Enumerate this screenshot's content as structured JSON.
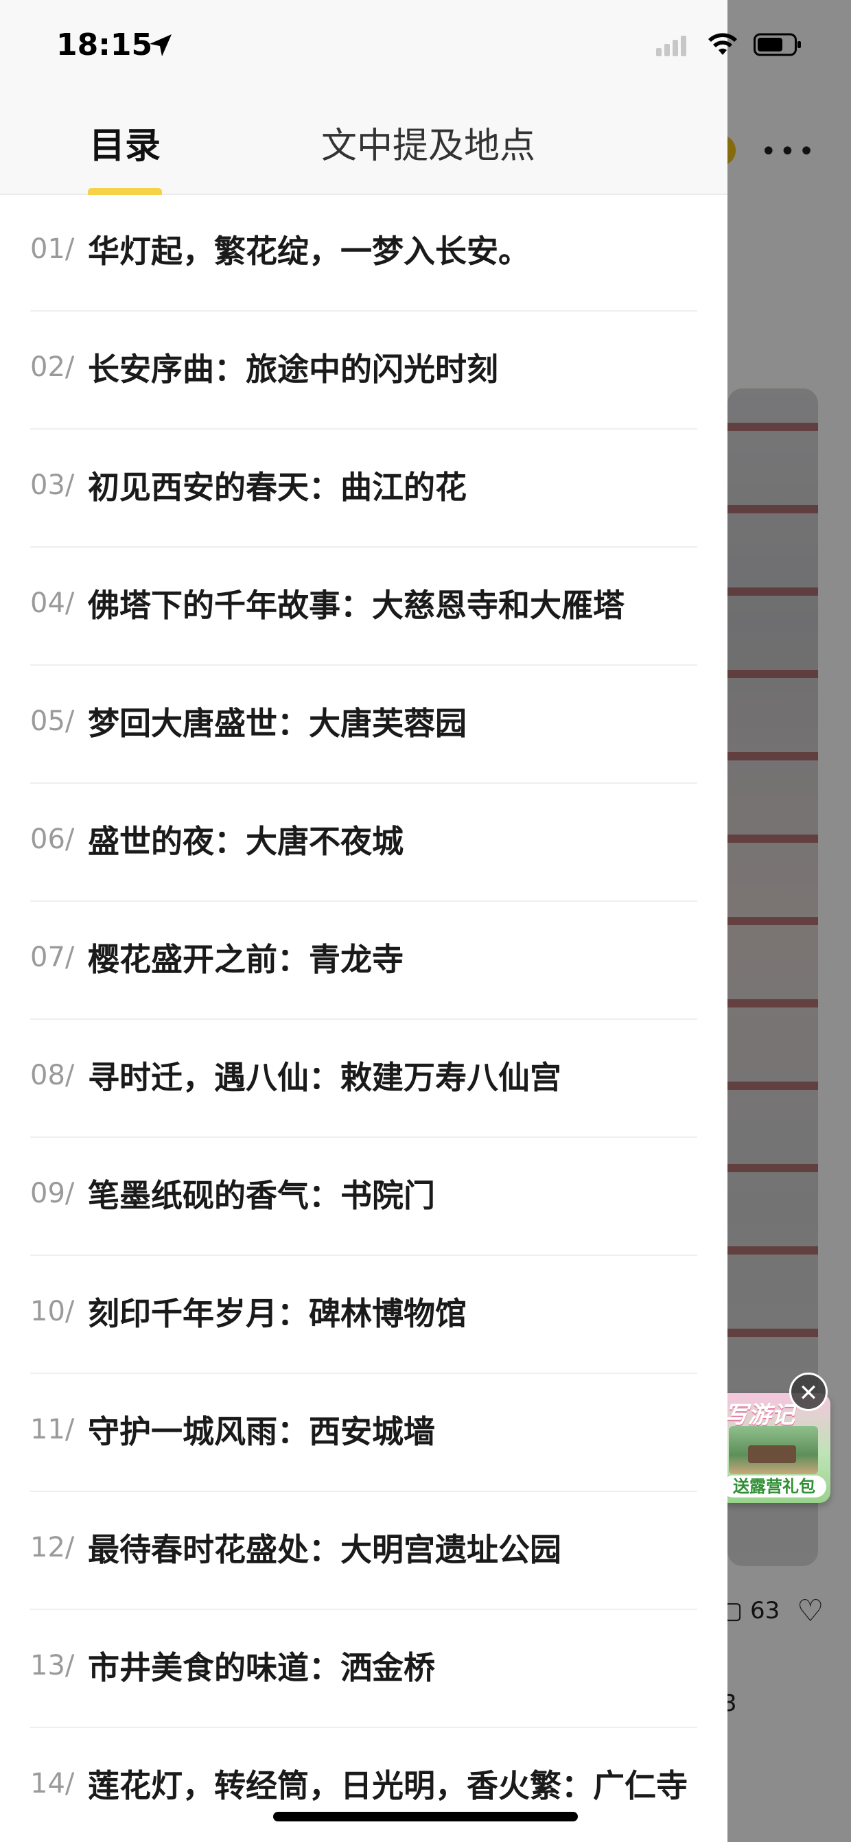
{
  "status_bar": {
    "time": "18:15"
  },
  "tabs": [
    {
      "label": "目录",
      "active": true
    },
    {
      "label": "文中提及地点",
      "active": false
    }
  ],
  "toc": [
    {
      "num": "01/",
      "title": "华灯起，繁花绽，一梦入长安。"
    },
    {
      "num": "02/",
      "title": "长安序曲：旅途中的闪光时刻"
    },
    {
      "num": "03/",
      "title": "初见西安的春天：曲江的花"
    },
    {
      "num": "04/",
      "title": "佛塔下的千年故事：大慈恩寺和大雁塔"
    },
    {
      "num": "05/",
      "title": "梦回大唐盛世：大唐芙蓉园"
    },
    {
      "num": "06/",
      "title": "盛世的夜：大唐不夜城"
    },
    {
      "num": "07/",
      "title": "樱花盛开之前：青龙寺"
    },
    {
      "num": "08/",
      "title": "寻时迁，遇八仙：敕建万寿八仙宫"
    },
    {
      "num": "09/",
      "title": "笔墨纸砚的香气：书院门"
    },
    {
      "num": "10/",
      "title": "刻印千年岁月：碑林博物馆"
    },
    {
      "num": "11/",
      "title": "守护一城风雨：西安城墙"
    },
    {
      "num": "12/",
      "title": "最待春时花盛处：大明宫遗址公园"
    },
    {
      "num": "13/",
      "title": "市井美食的味道：洒金桥"
    },
    {
      "num": "14/",
      "title": "莲花灯，转经筒，日光明，香火繁：广仁寺"
    }
  ],
  "background": {
    "more_label": "•••",
    "likes_count": "63",
    "partial_number": "3"
  },
  "promo": {
    "top_text": "写游记",
    "bottom_text": "送露营礼包",
    "close_label": "✕"
  },
  "colors": {
    "accent": "#f6d24a",
    "overlay": "rgba(0,0,0,0.45)"
  }
}
